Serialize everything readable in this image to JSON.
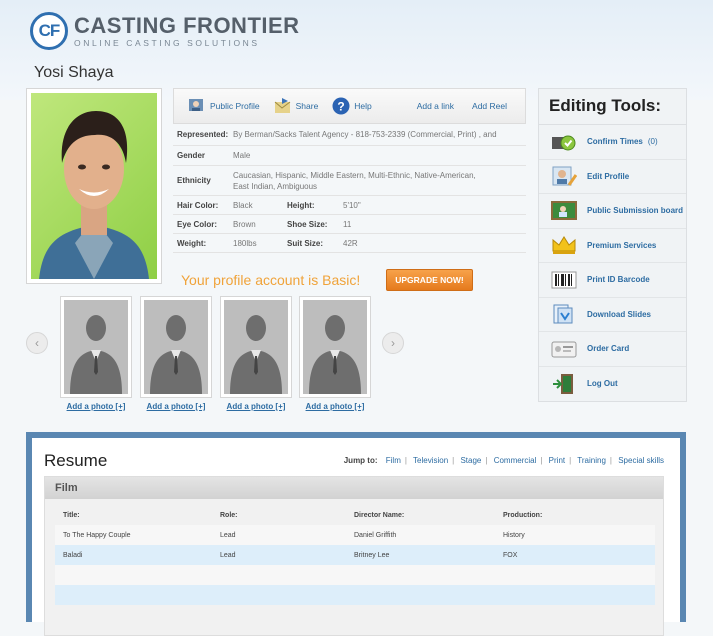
{
  "brand": {
    "initials": "CF",
    "name": "CASTING FRONTIER",
    "tagline": "ONLINE CASTING SOLUTIONS"
  },
  "profile": {
    "name": "Yosi Shaya",
    "actions": {
      "public_profile": "Public Profile",
      "share": "Share",
      "help": "Help",
      "add_link": "Add a link",
      "add_reel": "Add Reel"
    },
    "represented_label": "Represented:",
    "represented_value": "By Berman/Sacks Talent Agency - 818-753-2339 (Commercial, Print) , and",
    "gender_label": "Gender",
    "gender_value": "Male",
    "ethnicity_label": "Ethnicity",
    "ethnicity_line1": "Caucasian, Hispanic, Middle Eastern, Multi-Ethnic, Native-American,",
    "ethnicity_line2": "East Indian, Ambiguous",
    "hair_label": "Hair Color:",
    "hair_value": "Black",
    "height_label": "Height:",
    "height_value": "5'10\"",
    "eye_label": "Eye Color:",
    "eye_value": "Brown",
    "shoe_label": "Shoe Size:",
    "shoe_value": "11",
    "weight_label": "Weight:",
    "weight_value": "180lbs",
    "suit_label": "Suit Size:",
    "suit_value": "42R",
    "upgrade_text": "Your profile account is Basic!",
    "upgrade_button": "UPGRADE NOW!"
  },
  "gallery": {
    "add_photo_label": "Add a photo [+]",
    "prev_arrow": "‹",
    "next_arrow": "›"
  },
  "tools": {
    "title": "Editing Tools:",
    "items": [
      {
        "label": "Confirm Times",
        "count": "(0)",
        "icon": "clock-check-icon"
      },
      {
        "label": "Edit Profile",
        "icon": "edit-profile-icon"
      },
      {
        "label": "Public Submission board",
        "icon": "board-icon"
      },
      {
        "label": "Premium Services",
        "icon": "crown-icon"
      },
      {
        "label": "Print ID Barcode",
        "icon": "barcode-icon"
      },
      {
        "label": "Download Slides",
        "icon": "download-icon"
      },
      {
        "label": "Order Card",
        "icon": "card-icon"
      },
      {
        "label": "Log Out",
        "icon": "logout-icon"
      }
    ]
  },
  "resume": {
    "title": "Resume",
    "jump_label": "Jump to:",
    "jump_links": [
      "Film",
      "Television",
      "Stage",
      "Commercial",
      "Print",
      "Training",
      "Special skills"
    ],
    "section": "Film",
    "columns": [
      "Title:",
      "Role:",
      "Director Name:",
      "Production:"
    ],
    "rows": [
      [
        "To The Happy Couple",
        "Lead",
        "Daniel Griffith",
        "History"
      ],
      [
        "Baladi",
        "Lead",
        "Britney Lee",
        "FOX"
      ]
    ]
  }
}
